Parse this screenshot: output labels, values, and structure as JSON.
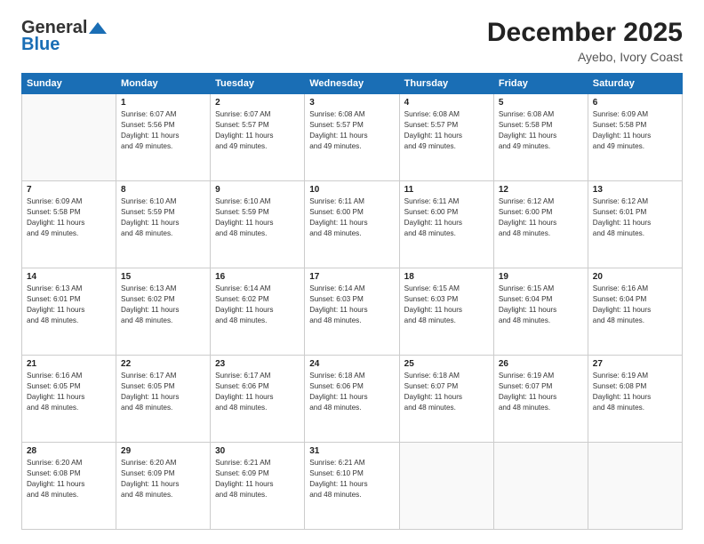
{
  "header": {
    "logo_general": "General",
    "logo_blue": "Blue",
    "month": "December 2025",
    "location": "Ayebo, Ivory Coast"
  },
  "days_of_week": [
    "Sunday",
    "Monday",
    "Tuesday",
    "Wednesday",
    "Thursday",
    "Friday",
    "Saturday"
  ],
  "weeks": [
    [
      {
        "day": "",
        "info": ""
      },
      {
        "day": "1",
        "info": "Sunrise: 6:07 AM\nSunset: 5:56 PM\nDaylight: 11 hours\nand 49 minutes."
      },
      {
        "day": "2",
        "info": "Sunrise: 6:07 AM\nSunset: 5:57 PM\nDaylight: 11 hours\nand 49 minutes."
      },
      {
        "day": "3",
        "info": "Sunrise: 6:08 AM\nSunset: 5:57 PM\nDaylight: 11 hours\nand 49 minutes."
      },
      {
        "day": "4",
        "info": "Sunrise: 6:08 AM\nSunset: 5:57 PM\nDaylight: 11 hours\nand 49 minutes."
      },
      {
        "day": "5",
        "info": "Sunrise: 6:08 AM\nSunset: 5:58 PM\nDaylight: 11 hours\nand 49 minutes."
      },
      {
        "day": "6",
        "info": "Sunrise: 6:09 AM\nSunset: 5:58 PM\nDaylight: 11 hours\nand 49 minutes."
      }
    ],
    [
      {
        "day": "7",
        "info": "Sunrise: 6:09 AM\nSunset: 5:58 PM\nDaylight: 11 hours\nand 49 minutes."
      },
      {
        "day": "8",
        "info": "Sunrise: 6:10 AM\nSunset: 5:59 PM\nDaylight: 11 hours\nand 48 minutes."
      },
      {
        "day": "9",
        "info": "Sunrise: 6:10 AM\nSunset: 5:59 PM\nDaylight: 11 hours\nand 48 minutes."
      },
      {
        "day": "10",
        "info": "Sunrise: 6:11 AM\nSunset: 6:00 PM\nDaylight: 11 hours\nand 48 minutes."
      },
      {
        "day": "11",
        "info": "Sunrise: 6:11 AM\nSunset: 6:00 PM\nDaylight: 11 hours\nand 48 minutes."
      },
      {
        "day": "12",
        "info": "Sunrise: 6:12 AM\nSunset: 6:00 PM\nDaylight: 11 hours\nand 48 minutes."
      },
      {
        "day": "13",
        "info": "Sunrise: 6:12 AM\nSunset: 6:01 PM\nDaylight: 11 hours\nand 48 minutes."
      }
    ],
    [
      {
        "day": "14",
        "info": "Sunrise: 6:13 AM\nSunset: 6:01 PM\nDaylight: 11 hours\nand 48 minutes."
      },
      {
        "day": "15",
        "info": "Sunrise: 6:13 AM\nSunset: 6:02 PM\nDaylight: 11 hours\nand 48 minutes."
      },
      {
        "day": "16",
        "info": "Sunrise: 6:14 AM\nSunset: 6:02 PM\nDaylight: 11 hours\nand 48 minutes."
      },
      {
        "day": "17",
        "info": "Sunrise: 6:14 AM\nSunset: 6:03 PM\nDaylight: 11 hours\nand 48 minutes."
      },
      {
        "day": "18",
        "info": "Sunrise: 6:15 AM\nSunset: 6:03 PM\nDaylight: 11 hours\nand 48 minutes."
      },
      {
        "day": "19",
        "info": "Sunrise: 6:15 AM\nSunset: 6:04 PM\nDaylight: 11 hours\nand 48 minutes."
      },
      {
        "day": "20",
        "info": "Sunrise: 6:16 AM\nSunset: 6:04 PM\nDaylight: 11 hours\nand 48 minutes."
      }
    ],
    [
      {
        "day": "21",
        "info": "Sunrise: 6:16 AM\nSunset: 6:05 PM\nDaylight: 11 hours\nand 48 minutes."
      },
      {
        "day": "22",
        "info": "Sunrise: 6:17 AM\nSunset: 6:05 PM\nDaylight: 11 hours\nand 48 minutes."
      },
      {
        "day": "23",
        "info": "Sunrise: 6:17 AM\nSunset: 6:06 PM\nDaylight: 11 hours\nand 48 minutes."
      },
      {
        "day": "24",
        "info": "Sunrise: 6:18 AM\nSunset: 6:06 PM\nDaylight: 11 hours\nand 48 minutes."
      },
      {
        "day": "25",
        "info": "Sunrise: 6:18 AM\nSunset: 6:07 PM\nDaylight: 11 hours\nand 48 minutes."
      },
      {
        "day": "26",
        "info": "Sunrise: 6:19 AM\nSunset: 6:07 PM\nDaylight: 11 hours\nand 48 minutes."
      },
      {
        "day": "27",
        "info": "Sunrise: 6:19 AM\nSunset: 6:08 PM\nDaylight: 11 hours\nand 48 minutes."
      }
    ],
    [
      {
        "day": "28",
        "info": "Sunrise: 6:20 AM\nSunset: 6:08 PM\nDaylight: 11 hours\nand 48 minutes."
      },
      {
        "day": "29",
        "info": "Sunrise: 6:20 AM\nSunset: 6:09 PM\nDaylight: 11 hours\nand 48 minutes."
      },
      {
        "day": "30",
        "info": "Sunrise: 6:21 AM\nSunset: 6:09 PM\nDaylight: 11 hours\nand 48 minutes."
      },
      {
        "day": "31",
        "info": "Sunrise: 6:21 AM\nSunset: 6:10 PM\nDaylight: 11 hours\nand 48 minutes."
      },
      {
        "day": "",
        "info": ""
      },
      {
        "day": "",
        "info": ""
      },
      {
        "day": "",
        "info": ""
      }
    ]
  ]
}
